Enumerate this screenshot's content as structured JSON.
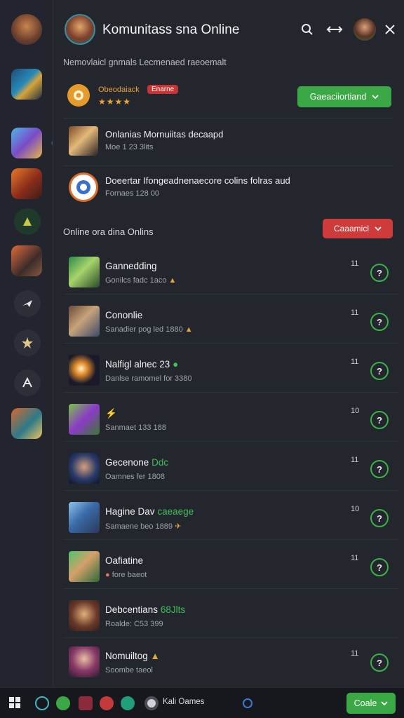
{
  "header": {
    "title": "Komunitass sna Online",
    "search_icon": "search-icon",
    "swap_icon": "swap-arrows-icon",
    "close_icon": "close-icon"
  },
  "subtitle": "Nemovlaicl gnmals Lecmenaed raeoemalt",
  "featured": {
    "name": "Obeodaiack",
    "badge": "Enarne",
    "stars": "★★★★",
    "button_label": "Gaeaciiortiand"
  },
  "notices": [
    {
      "title": "Onlanias Mornuiitas decaapd",
      "sub": "Moe 1 23 3lits"
    },
    {
      "title": "Doeertar Ifongeadnenaecore colins folras aud",
      "sub": "Fornaes 128 00"
    }
  ],
  "section": {
    "title": "Online ora dina Onlins",
    "button_label": "Caaamicl"
  },
  "rows": [
    {
      "name": "Gannedding",
      "sub": "Gonilcs fadc 1aco",
      "count": "11"
    },
    {
      "name": "Cononlie",
      "sub": "Sanadier pog led 1880",
      "count": "11"
    },
    {
      "name": "Nalfigl alnec 23",
      "sub": "Danlse ramomel for 3380",
      "count": "11"
    },
    {
      "name": "",
      "sub": "Sanmaet 133 188",
      "count": "10"
    },
    {
      "name": "Gecenone",
      "sub": "Oamnes fer 1808",
      "count": "11"
    },
    {
      "name": "Hagine Dav",
      "sub": "Samaene beo 1889",
      "count": "10"
    },
    {
      "name": "Oafiatine",
      "sub": "fore baeot",
      "count": "11"
    },
    {
      "name": "Debcentians",
      "sub": "Roalde: C53 399",
      "count": ""
    },
    {
      "name": "Nomuiltog",
      "sub": "Soombe taeol",
      "count": "11"
    }
  ],
  "row_tags": {
    "row3": "Ddc",
    "row6": "caeaege",
    "row8": "68Jlts"
  },
  "status_glyph": "?",
  "taskbar": {
    "label": "Kali Oames",
    "button_label": "Coale"
  },
  "colors": {
    "accent_green": "#3aa844",
    "accent_red": "#cf3b3b",
    "accent_gold": "#e0a83a"
  }
}
